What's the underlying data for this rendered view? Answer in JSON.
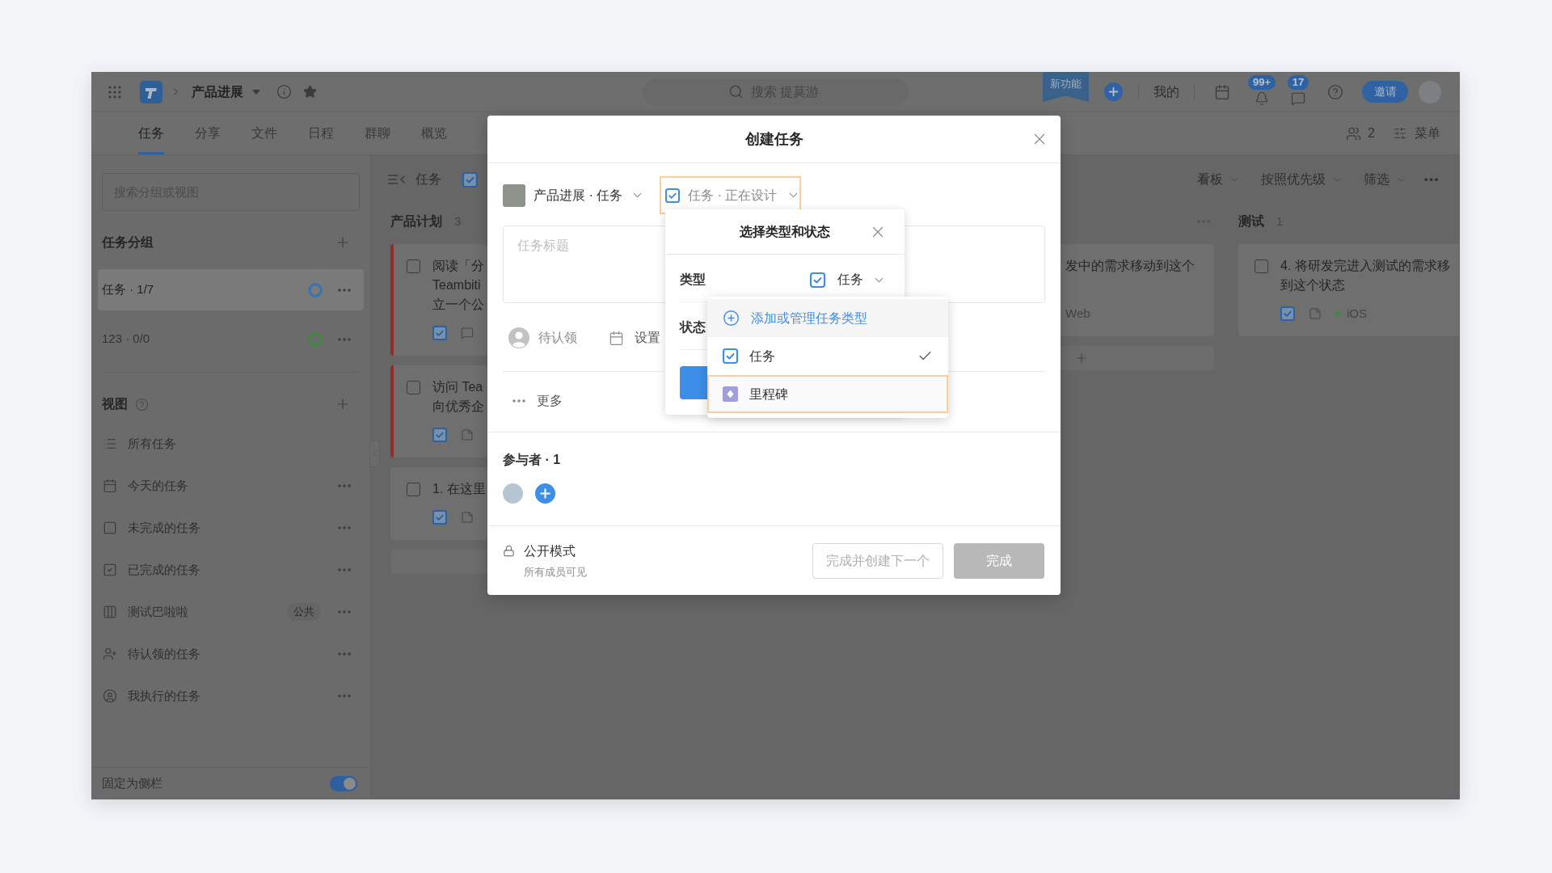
{
  "topbar": {
    "project": "产品进展",
    "search": {
      "placeholder": "搜索 提莫游"
    },
    "ribbon": "新功能",
    "mine": "我的",
    "alerts": [
      {
        "kind": "bell",
        "count": "99+"
      },
      {
        "kind": "inbox",
        "count": "17"
      }
    ],
    "invite": "邀请"
  },
  "tabs": [
    {
      "label": "任务",
      "selected": true
    },
    {
      "label": "分享",
      "selected": false
    },
    {
      "label": "文件",
      "selected": false
    },
    {
      "label": "日程",
      "selected": false
    },
    {
      "label": "群聊",
      "selected": false
    },
    {
      "label": "概览",
      "selected": false
    }
  ],
  "tab_actions": {
    "members": "2",
    "menu": "菜单"
  },
  "sidebar": {
    "search": {
      "placeholder": "搜索分组或视图"
    },
    "groups_title": "任务分组",
    "groups": [
      {
        "label": "任务 · 1/7",
        "selected": true,
        "color": "#3673b6"
      },
      {
        "label": "123 · 0/0",
        "selected": false,
        "color": "#3c8a3f"
      }
    ],
    "views_title": "视图",
    "views": [
      {
        "kind": "list",
        "label": "所有任务",
        "more": false
      },
      {
        "kind": "calendar",
        "label": "今天的任务",
        "more": true
      },
      {
        "kind": "todo",
        "label": "未完成的任务",
        "more": true
      },
      {
        "kind": "done",
        "label": "已完成的任务",
        "more": true
      },
      {
        "kind": "board",
        "label": "测试巴啦啦",
        "badge": "公共",
        "more": true
      },
      {
        "kind": "claim",
        "label": "待认领的任务",
        "more": true
      },
      {
        "kind": "mine",
        "label": "我执行的任务",
        "more": true
      }
    ],
    "pin": {
      "label": "固定为侧栏",
      "on": true
    }
  },
  "board": {
    "title": "任务",
    "controls": [
      "看板",
      "按照优先级",
      "筛选"
    ],
    "columns": [
      {
        "title": "产品计划",
        "count": "3",
        "cards": [
          {
            "lines": [
              "阅读「分",
              "Teambiti",
              "立一个公"
            ],
            "done": false,
            "flagged": true,
            "icons": [
              {
                "kind": "task"
              },
              {
                "kind": "comment"
              }
            ]
          },
          {
            "lines": [
              "访问 Tea",
              "向优秀企"
            ],
            "done": false,
            "flagged": true,
            "icons": [
              {
                "kind": "task"
              },
              {
                "kind": "note"
              }
            ]
          },
          {
            "lines": [
              "1. 在这里"
            ],
            "done": false,
            "flagged": false,
            "icons": [
              {
                "kind": "task"
              },
              {
                "kind": "note"
              }
            ]
          }
        ],
        "add_row": {
          "plus": false
        }
      },
      {
        "more": true,
        "cards": [
          {
            "lines": [
              "发中的需求移动到这个"
            ],
            "tags": [
              {
                "label": "Web"
              }
            ]
          }
        ],
        "add_row": {
          "plus": true
        }
      },
      {
        "title": "测试",
        "count": "1",
        "cards": [
          {
            "lines": [
              "4. 将研发完进入测试的需求移",
              "到这个状态"
            ],
            "done": false,
            "flagged": false,
            "icons": [
              {
                "kind": "task"
              },
              {
                "kind": "note"
              }
            ],
            "tags": [
              {
                "label": "iOS",
                "color": "#3c8a3f"
              }
            ]
          }
        ]
      }
    ]
  },
  "modal": {
    "title": "创建任务",
    "project": "产品进展 · 任务",
    "type_status": {
      "label": "任务 · 正在设计",
      "highlighted": true
    },
    "title_field": {
      "placeholder": "任务标题"
    },
    "assignee": "待认领",
    "due": "设置",
    "more": "更多",
    "participants_title": "参与者 · 1",
    "visibility": {
      "title": "公开模式",
      "note": "所有成员可见"
    },
    "buttons": [
      {
        "kind": "outline",
        "label": "完成并创建下一个",
        "disabled": true
      },
      {
        "kind": "primary",
        "label": "完成",
        "disabled": true
      }
    ]
  },
  "type_popover": {
    "title": "选择类型和状态",
    "rows": [
      {
        "label": "类型",
        "value": "任务"
      },
      {
        "label": "状态"
      }
    ],
    "options": [
      {
        "kind": "manage",
        "label": "添加或管理任务类型",
        "selected": false,
        "highlighted": false
      },
      {
        "kind": "task",
        "label": "任务",
        "selected": true,
        "highlighted": false
      },
      {
        "kind": "milestone",
        "label": "里程碑",
        "selected": false,
        "highlighted": true
      }
    ]
  }
}
